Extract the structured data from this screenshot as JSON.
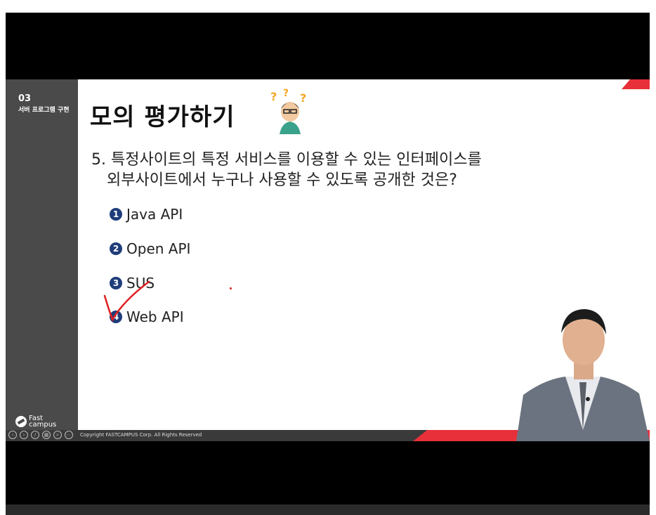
{
  "sidebar": {
    "section_number": "03",
    "section_title": "서버 프로그램 구현",
    "logo_line1": "Fast",
    "logo_line2": "campus"
  },
  "slide": {
    "title": "모의 평가하기",
    "question_line1": "5. 특정사이트의 특정 서비스를 이용할 수 있는 인터페이스를",
    "question_line2": "외부사이트에서 누구나 사용할 수 있도록 공개한 것은?",
    "options": [
      {
        "num": "1",
        "label": "Java API"
      },
      {
        "num": "2",
        "label": "Open API"
      },
      {
        "num": "3",
        "label": "SUS"
      },
      {
        "num": "4",
        "label": "Web API"
      }
    ]
  },
  "footer": {
    "copyright": "Copyright FASTCAMPUS Corp. All Rights Reserved"
  },
  "colors": {
    "accent_red": "#e8303a",
    "sidebar_gray": "#4a4a4a",
    "option_badge": "#1f3d7a",
    "annotation": "#e02020"
  }
}
